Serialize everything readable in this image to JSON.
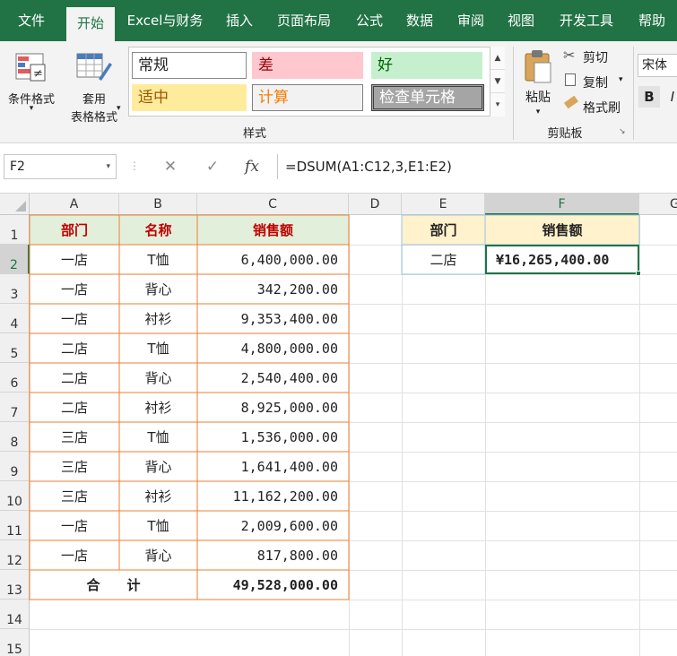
{
  "tabs": [
    "文件",
    "开始",
    "Excel与财务",
    "插入",
    "页面布局",
    "公式",
    "数据",
    "审阅",
    "视图",
    "开发工具",
    "帮助"
  ],
  "ribbon": {
    "conditional_format": "条件格式",
    "table_format_line1": "套用",
    "table_format_line2": "表格格式",
    "styles": {
      "normal": "常规",
      "bad": "差",
      "good": "好",
      "neutral": "适中",
      "calculation": "计算",
      "check_cell": "检查单元格"
    },
    "styles_group": "样式",
    "paste": "粘贴",
    "cut": "剪切",
    "copy": "复制",
    "format_painter": "格式刷",
    "clipboard_group": "剪贴板",
    "font_name": "宋体",
    "bold": "B",
    "italic": "I"
  },
  "formula_bar": {
    "name_box": "F2",
    "cancel": "✕",
    "enter": "✓",
    "fx": "fx",
    "formula": "=DSUM(A1:C12,3,E1:E2)"
  },
  "columns": [
    "A",
    "B",
    "C",
    "D",
    "E",
    "F",
    "G"
  ],
  "rows": [
    "1",
    "2",
    "3",
    "4",
    "5",
    "6",
    "7",
    "8",
    "9",
    "10",
    "11",
    "12",
    "13",
    "14",
    "15"
  ],
  "table": {
    "headers": [
      "部门",
      "名称",
      "销售额"
    ],
    "rows": [
      [
        "一店",
        "T恤",
        "6,400,000.00"
      ],
      [
        "一店",
        "背心",
        "342,200.00"
      ],
      [
        "一店",
        "衬衫",
        "9,353,400.00"
      ],
      [
        "二店",
        "T恤",
        "4,800,000.00"
      ],
      [
        "二店",
        "背心",
        "2,540,400.00"
      ],
      [
        "二店",
        "衬衫",
        "8,925,000.00"
      ],
      [
        "三店",
        "T恤",
        "1,536,000.00"
      ],
      [
        "三店",
        "背心",
        "1,641,400.00"
      ],
      [
        "三店",
        "衬衫",
        "11,162,200.00"
      ],
      [
        "一店",
        "T恤",
        "2,009,600.00"
      ],
      [
        "一店",
        "背心",
        "817,800.00"
      ]
    ],
    "total_label": "合　　计",
    "total_value": "49,528,000.00"
  },
  "criteria": {
    "header_dept": "部门",
    "header_sales": "销售额",
    "dept_value": "二店",
    "result": "¥16,265,400.00"
  },
  "colors": {
    "excel_green": "#217346",
    "header_fill": "#e2efda",
    "header_text": "#c00000",
    "table_border": "#ed7d31",
    "criteria_header_fill": "#fff2cc",
    "criteria_border": "#9bc2e6"
  }
}
